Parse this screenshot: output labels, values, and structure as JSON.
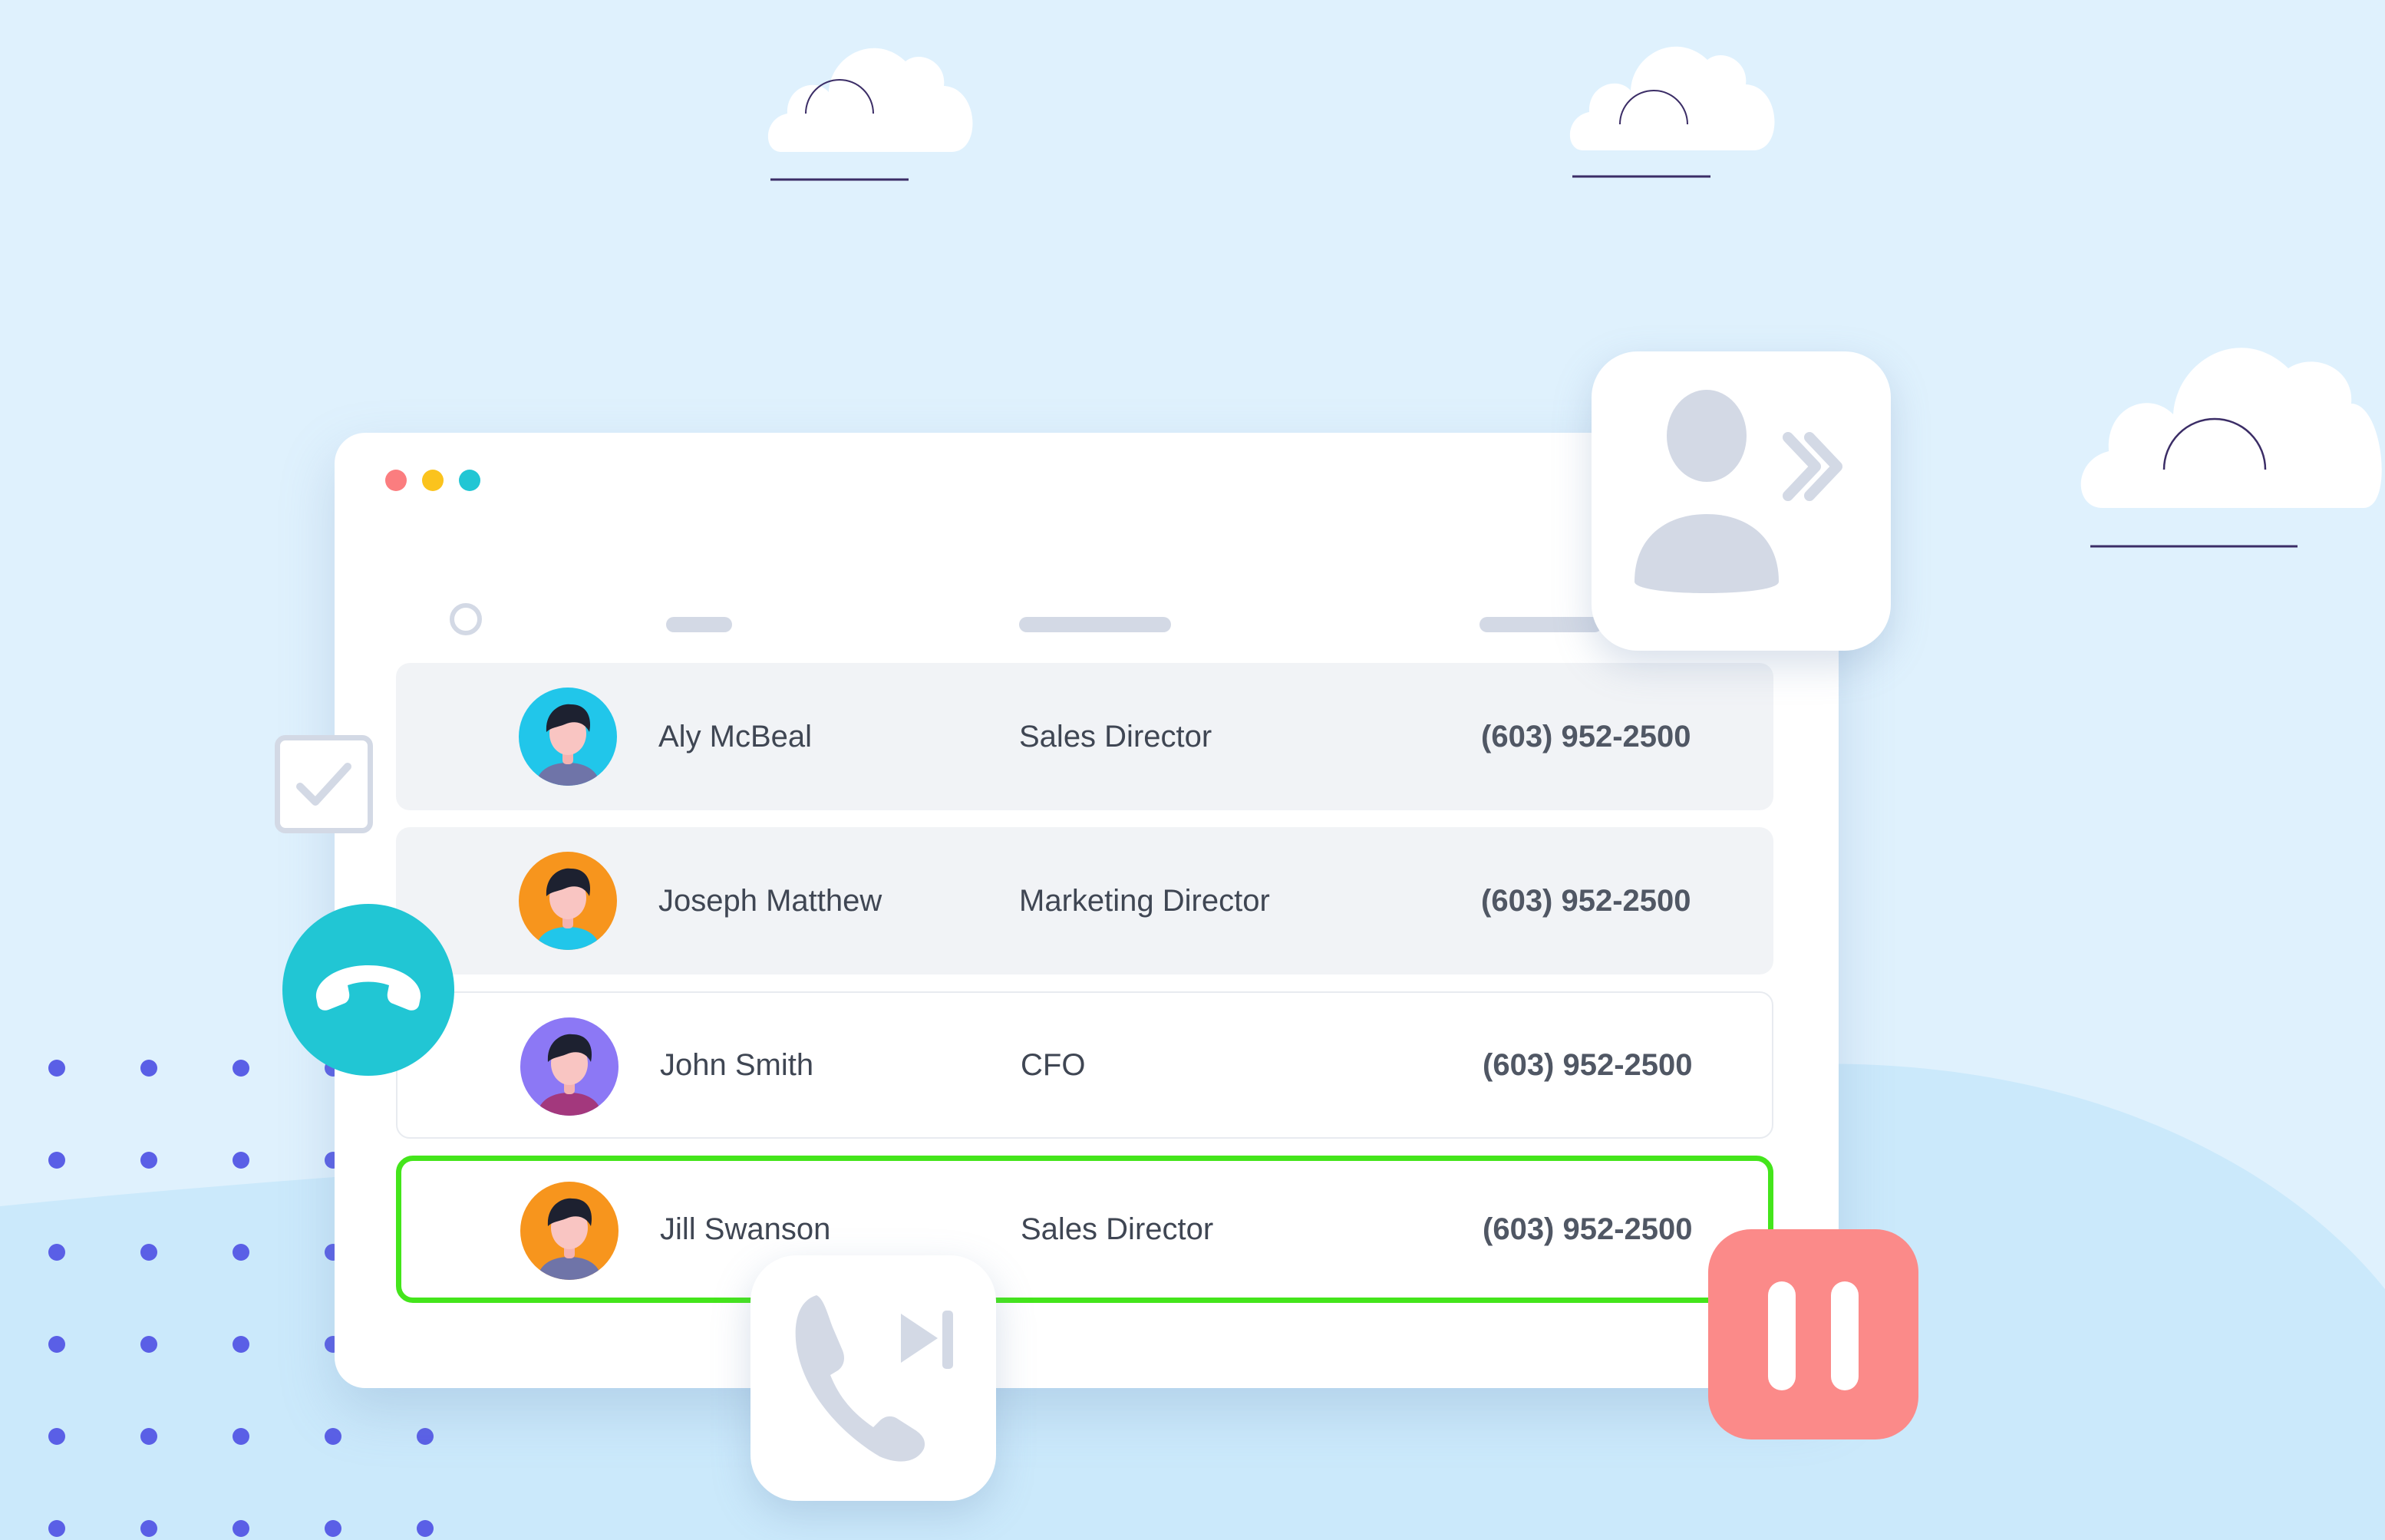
{
  "window": {
    "traffic_lights": [
      "close",
      "minimize",
      "maximize"
    ],
    "colors": {
      "close": "#fb7d7f",
      "minimize": "#fbc31d",
      "maximize": "#21c6d4"
    }
  },
  "contacts": [
    {
      "name": "Aly McBeal",
      "title": "Sales Director",
      "phone": "(603) 952-2500",
      "avatar_color": "#21c6ea",
      "shirt_color": "#6f74a8",
      "state": "shaded"
    },
    {
      "name": "Joseph Matthew",
      "title": "Marketing Director",
      "phone": "(603) 952-2500",
      "avatar_color": "#f7951d",
      "shirt_color": "#21c6ea",
      "state": "shaded"
    },
    {
      "name": "John Smith",
      "title": "CFO",
      "phone": "(603) 952-2500",
      "avatar_color": "#8c78f5",
      "shirt_color": "#a3387d",
      "state": "plain"
    },
    {
      "name": "Jill Swanson",
      "title": "Sales Director",
      "phone": "(603) 952-2500",
      "avatar_color": "#f7951d",
      "shirt_color": "#6f74a8",
      "state": "selected"
    }
  ],
  "icons": {
    "transfer": "contact-forward-icon",
    "skip_call": "phone-skip-icon",
    "pause": "pause-icon",
    "hangup": "hang-up-icon",
    "checkbox": "checkbox-checked-icon"
  },
  "colors": {
    "background": "#dff1fd",
    "selected_border": "#44e51b",
    "pause": "#fb8a89",
    "hangup": "#21c6d4",
    "icon_gray": "#d3d9e5",
    "dots": "#5a5fe6"
  }
}
